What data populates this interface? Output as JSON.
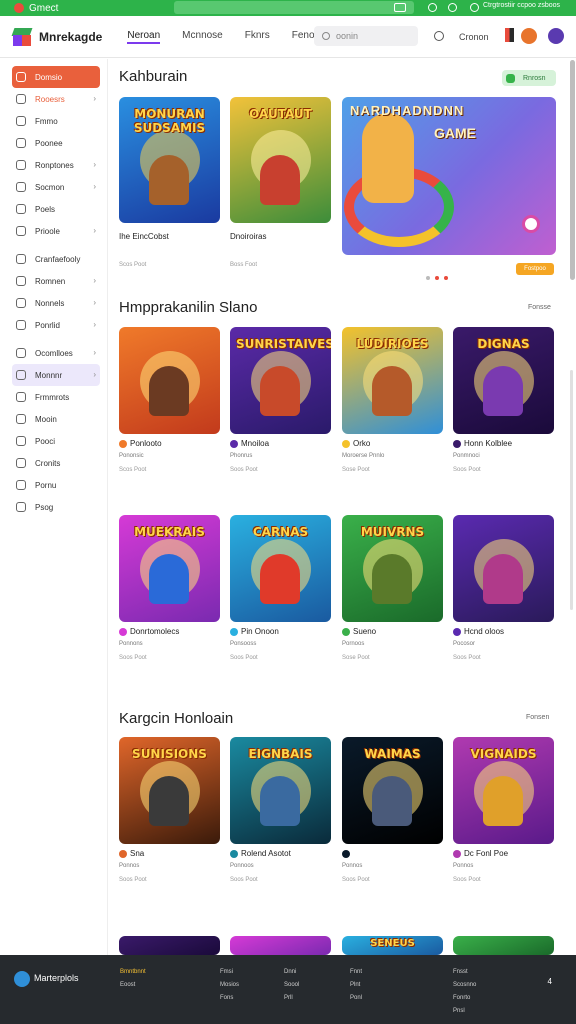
{
  "browser": {
    "title": "Gmect",
    "right_text": "Ctrgtrostiir ccpoo zsboos"
  },
  "header": {
    "brand": "Mnrekagde",
    "nav": [
      "Neroan",
      "Mcnnose",
      "Fknrs",
      "Feno"
    ],
    "search_placeholder": "oonin",
    "link": "Cronon"
  },
  "sidebar": {
    "items": [
      {
        "label": "Domsio",
        "chev": false,
        "style": "red"
      },
      {
        "label": "Rooesrs",
        "chev": true,
        "style": "orange-text"
      },
      {
        "label": "Fmmo",
        "chev": false
      },
      {
        "label": "Poonee",
        "chev": false
      },
      {
        "label": "Ronptones",
        "chev": true
      },
      {
        "label": "Socmon",
        "chev": true
      },
      {
        "label": "Poels",
        "chev": false
      },
      {
        "label": "Prioole",
        "chev": true
      },
      {
        "label": "Cranfaefooly",
        "chev": false
      },
      {
        "label": "Romnen",
        "chev": true
      },
      {
        "label": "Nonnels",
        "chev": true
      },
      {
        "label": "Ponrlid",
        "chev": true
      },
      {
        "label": "Ocomlloes",
        "chev": true
      },
      {
        "label": "Monnnr",
        "chev": true,
        "style": "sel"
      },
      {
        "label": "Frmmrots",
        "chev": false
      },
      {
        "label": "Mooin",
        "chev": false
      },
      {
        "label": "Pooci",
        "chev": false
      },
      {
        "label": "Cronits",
        "chev": false
      },
      {
        "label": "Pornu",
        "chev": false
      },
      {
        "label": "Psog",
        "chev": false
      }
    ]
  },
  "section1": {
    "title": "Kahburain",
    "pill": "Rnrosn",
    "hero_title": "NARDHADNDNN",
    "hero_title2": "GAME",
    "hero_button": "Fostpoo",
    "cards": [
      {
        "art": "MONURAN SUDSAMIS",
        "name": "Ihe EincCobst",
        "meta": "",
        "meta2": "Scos Poot"
      },
      {
        "art": "OAUTAUT",
        "name": "Dnoiroiras",
        "meta": "",
        "meta2": "Boss Foot"
      }
    ]
  },
  "section2": {
    "title": "Hmpprakanilin Slano",
    "link": "Fonsse",
    "cards": [
      {
        "art": "",
        "name": "Ponlooto",
        "meta": "Pononsic",
        "meta2": "Scos Poot"
      },
      {
        "art": "SUNRISTAIVES",
        "name": "Mnoiloa",
        "meta": "Phonrus",
        "meta2": "Soos Poot"
      },
      {
        "art": "LUDIRIOES",
        "name": "Orko",
        "meta": "Moroerse Pnnlo",
        "meta2": "Sose Poot"
      },
      {
        "art": "DIGNAS",
        "name": "Honn Kolblee",
        "meta": "Ponmnoci",
        "meta2": "Soos Poot"
      },
      {
        "art": "MUEKRAIS",
        "name": "Donrtomolecs",
        "meta": "Ponnons",
        "meta2": "Soos Poot"
      },
      {
        "art": "CARNAS",
        "name": "Pin Onoon",
        "meta": "Ponsooss",
        "meta2": "Soos Poot"
      },
      {
        "art": "MUIVRNS",
        "name": "Sueno",
        "meta": "Pornoos",
        "meta2": "Sose Poot"
      },
      {
        "art": "",
        "name": "Hcnd oloos",
        "meta": "Pocosor",
        "meta2": "Soos Poot"
      }
    ]
  },
  "section3": {
    "title": "Kargcin Honloain",
    "link": "Fonsen",
    "cards": [
      {
        "art": "SUNISIONS",
        "name": "Sna",
        "meta": "Ponnos",
        "meta2": "Soos Poot"
      },
      {
        "art": "EIGNBAIS",
        "name": "Rolend Asotot",
        "meta": "Ponnoos",
        "meta2": "Soos Poot"
      },
      {
        "art": "WAIMAS",
        "name": "",
        "meta": "Ponnos",
        "meta2": "Soos Poot"
      },
      {
        "art": "VIGNAIDS",
        "name": "Dc Fonl Poe",
        "meta": "Ponnos",
        "meta2": "Soos Poot"
      }
    ]
  },
  "section4": {
    "art": [
      "",
      "",
      "SENEUS",
      ""
    ]
  },
  "footer": {
    "brand": "Marterplols",
    "col1": [
      "Bmntbnnt",
      "",
      "Eoost"
    ],
    "col2": [
      "Fmsi",
      "Mosios",
      "Fons"
    ],
    "col3": [
      "Dnni",
      "Soool",
      "Prll"
    ],
    "col4": [
      "Fnnt",
      "Plnt",
      "Ponl"
    ],
    "col5": [
      "Fnsst",
      "Scosnno",
      "Fonrto",
      "Pnsl"
    ],
    "cap": "4"
  },
  "colors": {
    "accent": "#7c3aed",
    "primary_red": "#e9603c",
    "topbar_green": "#2db34a",
    "footer_bg": "#262a2e"
  }
}
